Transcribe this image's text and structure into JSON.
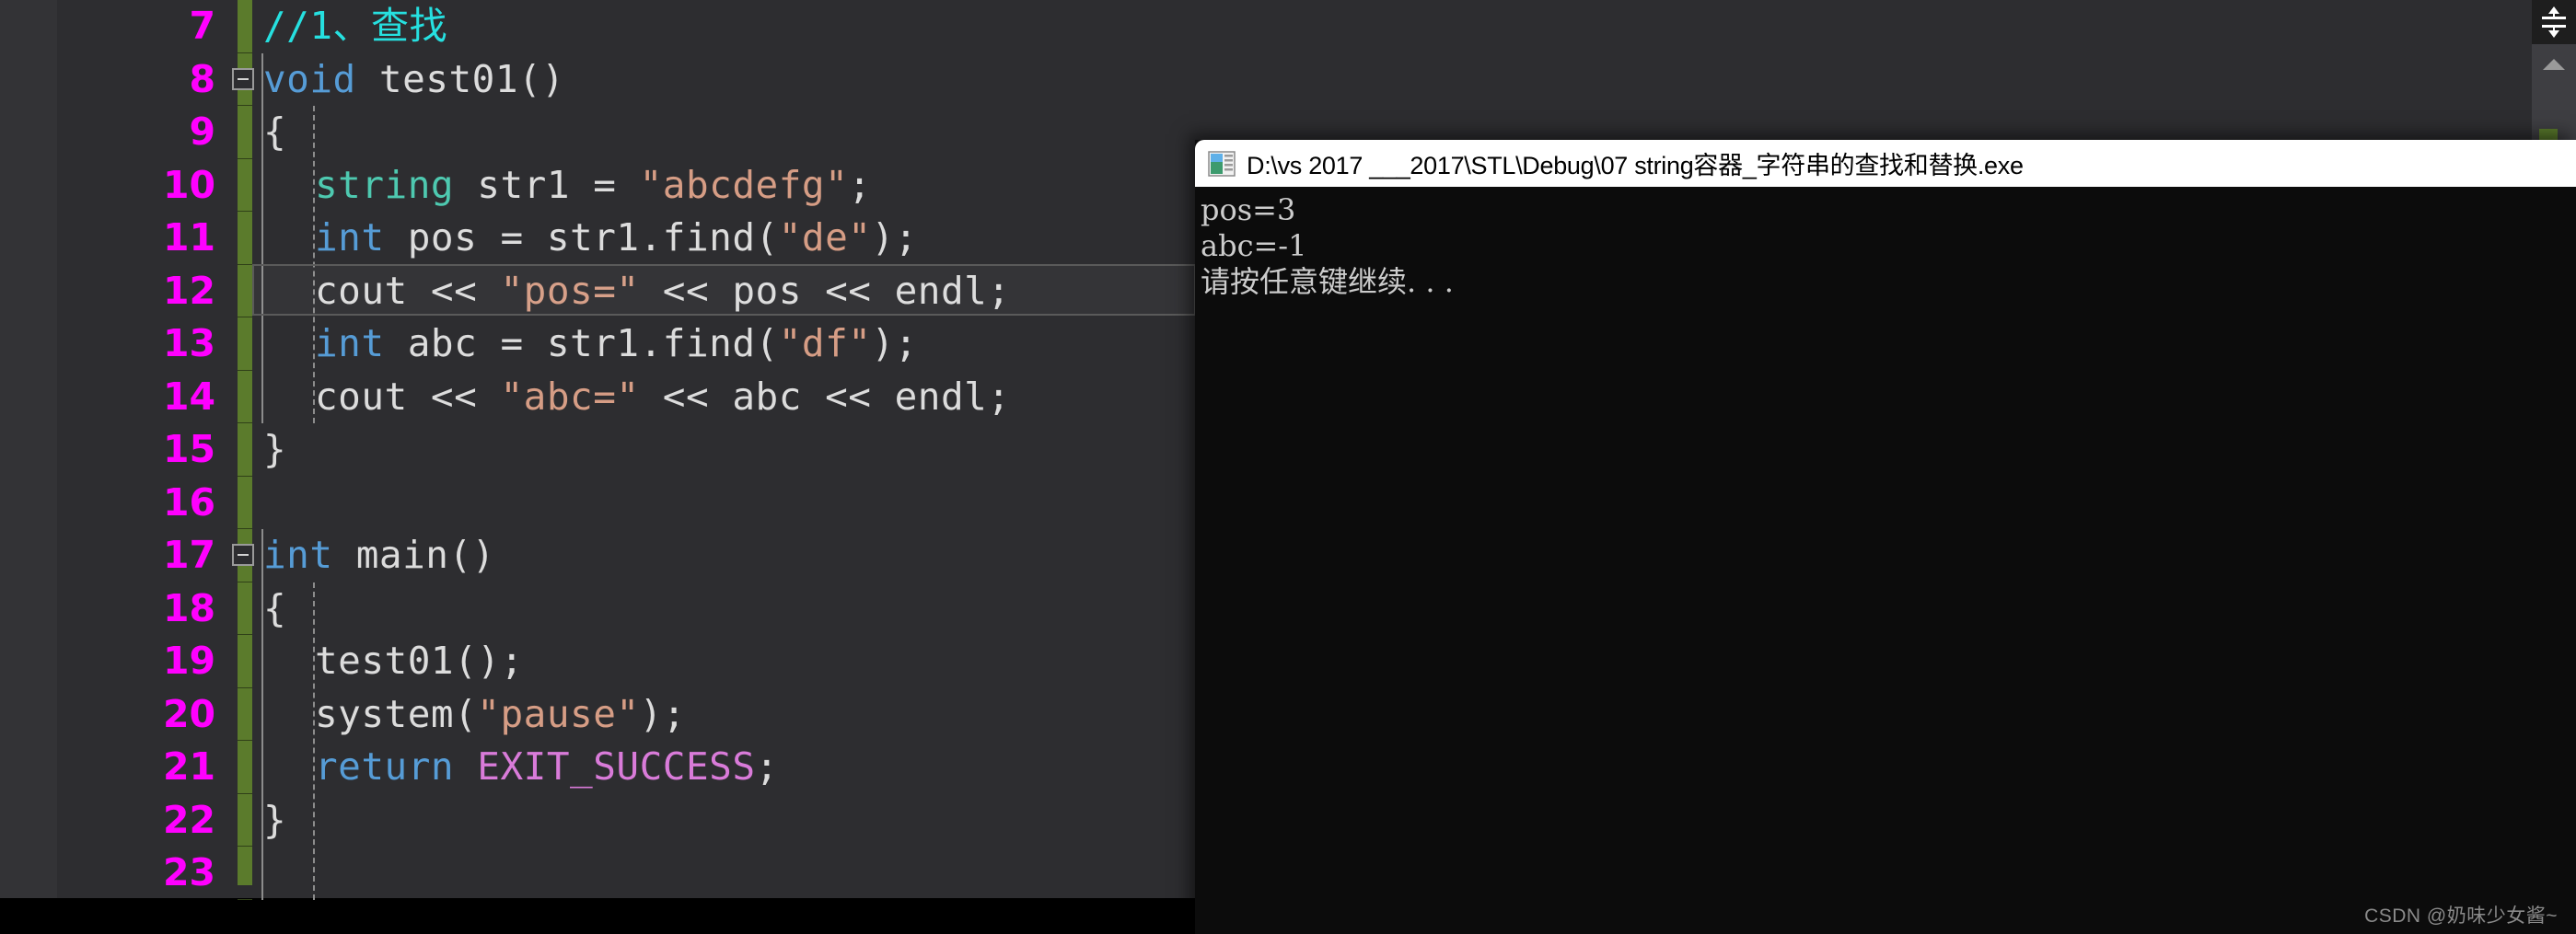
{
  "editor": {
    "gutter_color": "#ff00ff",
    "background": "#2d2d30",
    "change_bar_color": "#5b7b2c",
    "first_line_number": 7,
    "lines": [
      {
        "num": "7",
        "fold": false,
        "indent": 0,
        "tokens": [
          {
            "t": "//1、查找",
            "c": "cmt"
          }
        ]
      },
      {
        "num": "8",
        "fold": true,
        "indent": 0,
        "tokens": [
          {
            "t": "void",
            "c": "kw"
          },
          {
            "t": " test01()",
            "c": "plain"
          }
        ]
      },
      {
        "num": "9",
        "fold": false,
        "indent": 0,
        "tokens": [
          {
            "t": "{",
            "c": "brace"
          }
        ]
      },
      {
        "num": "10",
        "fold": false,
        "indent": 1,
        "tokens": [
          {
            "t": "string",
            "c": "type"
          },
          {
            "t": " str1 = ",
            "c": "plain"
          },
          {
            "t": "\"abcdefg\"",
            "c": "str"
          },
          {
            "t": ";",
            "c": "plain"
          }
        ]
      },
      {
        "num": "11",
        "fold": false,
        "indent": 1,
        "tokens": [
          {
            "t": "int",
            "c": "kw"
          },
          {
            "t": " pos = str1.find(",
            "c": "plain"
          },
          {
            "t": "\"de\"",
            "c": "str"
          },
          {
            "t": ");",
            "c": "plain"
          }
        ]
      },
      {
        "num": "12",
        "fold": false,
        "indent": 1,
        "tokens": [
          {
            "t": "cout << ",
            "c": "plain"
          },
          {
            "t": "\"pos=\"",
            "c": "str"
          },
          {
            "t": " << pos << endl;",
            "c": "plain"
          }
        ]
      },
      {
        "num": "13",
        "fold": false,
        "indent": 1,
        "tokens": [
          {
            "t": "int",
            "c": "kw"
          },
          {
            "t": " abc = str1.find(",
            "c": "plain"
          },
          {
            "t": "\"df\"",
            "c": "str"
          },
          {
            "t": ");",
            "c": "plain"
          }
        ]
      },
      {
        "num": "14",
        "fold": false,
        "indent": 1,
        "tokens": [
          {
            "t": "cout << ",
            "c": "plain"
          },
          {
            "t": "\"abc=\"",
            "c": "str"
          },
          {
            "t": " << abc << endl;",
            "c": "plain"
          }
        ]
      },
      {
        "num": "15",
        "fold": false,
        "indent": 0,
        "tokens": [
          {
            "t": "}",
            "c": "brace"
          }
        ]
      },
      {
        "num": "16",
        "fold": false,
        "indent": 0,
        "tokens": []
      },
      {
        "num": "17",
        "fold": true,
        "indent": 0,
        "tokens": [
          {
            "t": "int",
            "c": "kw"
          },
          {
            "t": " main()",
            "c": "plain"
          }
        ]
      },
      {
        "num": "18",
        "fold": false,
        "indent": 0,
        "tokens": [
          {
            "t": "{",
            "c": "brace"
          }
        ]
      },
      {
        "num": "19",
        "fold": false,
        "indent": 1,
        "tokens": [
          {
            "t": "test01();",
            "c": "plain"
          }
        ]
      },
      {
        "num": "20",
        "fold": false,
        "indent": 1,
        "tokens": [
          {
            "t": "system(",
            "c": "plain"
          },
          {
            "t": "\"pause\"",
            "c": "str"
          },
          {
            "t": ");",
            "c": "plain"
          }
        ]
      },
      {
        "num": "21",
        "fold": false,
        "indent": 1,
        "tokens": [
          {
            "t": "return",
            "c": "kw"
          },
          {
            "t": " ",
            "c": "plain"
          },
          {
            "t": "EXIT_SUCCESS",
            "c": "mac"
          },
          {
            "t": ";",
            "c": "plain"
          }
        ]
      },
      {
        "num": "22",
        "fold": false,
        "indent": 0,
        "tokens": [
          {
            "t": "}",
            "c": "brace"
          }
        ]
      },
      {
        "num": "23",
        "fold": false,
        "indent": 0,
        "tokens": []
      }
    ],
    "current_line": "12",
    "split_view_icon": "split-view-icon",
    "scroll_up_icon": "scroll-up-arrow-icon"
  },
  "console": {
    "icon": "console-app-icon",
    "title": "D:\\vs 2017 ___2017\\STL\\Debug\\07 string容器_字符串的查找和替换.exe",
    "output": [
      "pos=3",
      "abc=-1",
      "请按任意键继续. . ."
    ]
  },
  "watermark": {
    "text": "CSDN @奶味少女酱~"
  }
}
